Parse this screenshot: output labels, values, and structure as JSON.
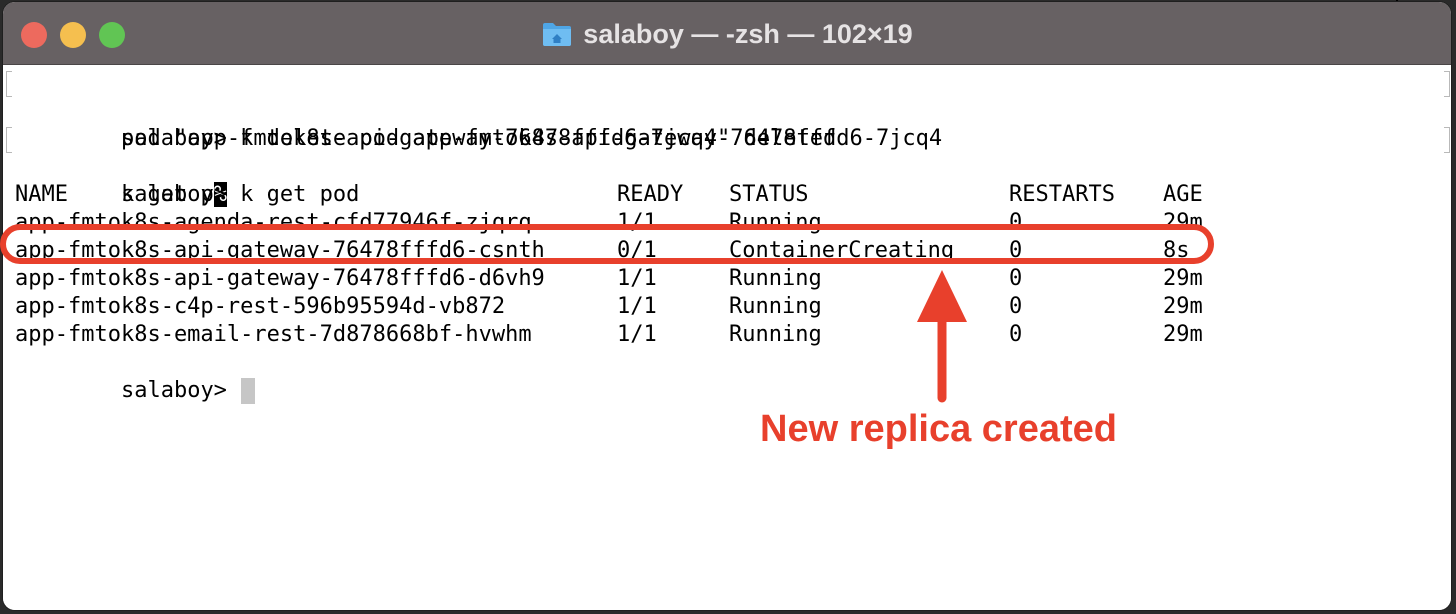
{
  "window": {
    "title": "salaboy — -zsh — 102×19",
    "icon": "folder-home-icon",
    "traffic_lights": [
      "close",
      "minimize",
      "zoom"
    ]
  },
  "terminal": {
    "lines": [
      {
        "text": "salaboy> k delete pod app-fmtok8s-api-gateway-76478fffd6-7jcq4",
        "bracketed": true
      },
      {
        "text": "pod \"app-fmtok8s-api-gateway-76478fffd6-7jcq4\" deleted",
        "bracketed": false
      },
      {
        "prefix": "k get p",
        "inverse": "%",
        "bracketed": true
      },
      {
        "text": "salaboy> k get pod",
        "bracketed": false
      }
    ],
    "table": {
      "headers": [
        "NAME",
        "READY",
        "STATUS",
        "RESTARTS",
        "AGE"
      ],
      "rows": [
        [
          "app-fmtok8s-agenda-rest-cfd77946f-zjqrq",
          "1/1",
          "Running",
          "0",
          "29m"
        ],
        [
          "app-fmtok8s-api-gateway-76478fffd6-csnth",
          "0/1",
          "ContainerCreating",
          "0",
          "8s"
        ],
        [
          "app-fmtok8s-api-gateway-76478fffd6-d6vh9",
          "1/1",
          "Running",
          "0",
          "29m"
        ],
        [
          "app-fmtok8s-c4p-rest-596b95594d-vb872",
          "1/1",
          "Running",
          "0",
          "29m"
        ],
        [
          "app-fmtok8s-email-rest-7d878668bf-hvwhm",
          "1/1",
          "Running",
          "0",
          "29m"
        ]
      ]
    },
    "prompt": "salaboy>"
  },
  "annotation": {
    "text": "New replica created",
    "color": "#e8402c"
  }
}
